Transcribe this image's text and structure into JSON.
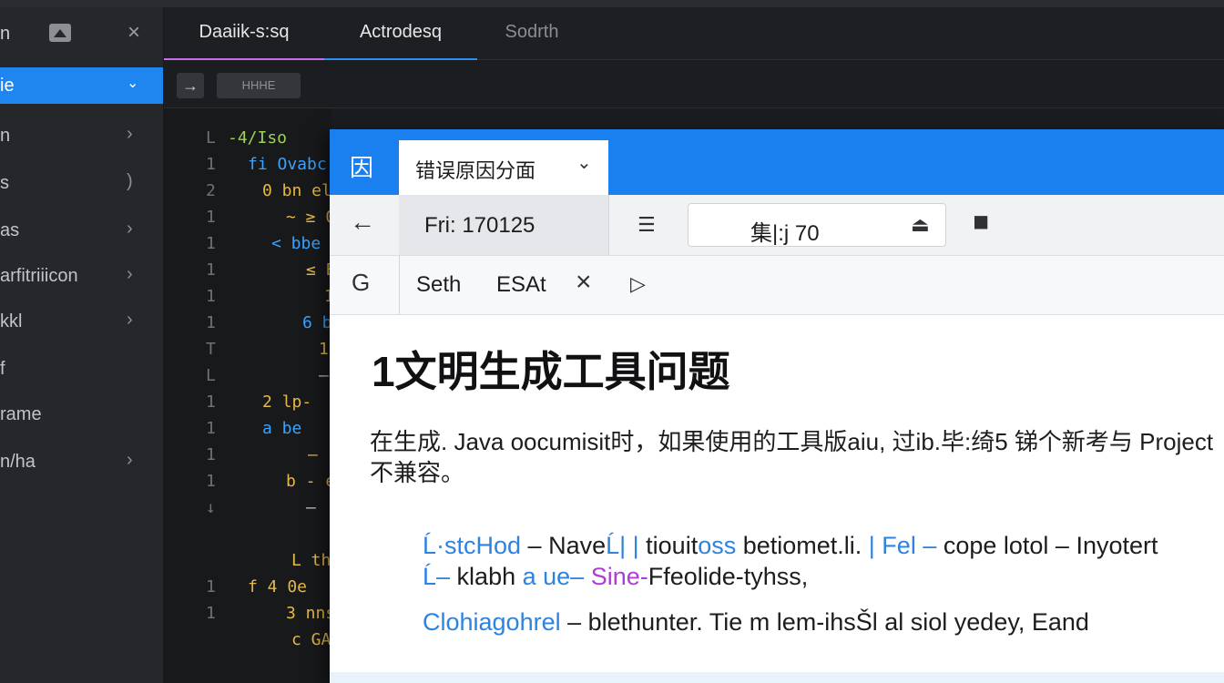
{
  "sidebar": {
    "header_text": "n",
    "items": [
      {
        "label": "ie",
        "chevron": "⌄",
        "active": true
      },
      {
        "label": "n",
        "chevron": "›"
      },
      {
        "label": "s",
        "chevron": ")"
      },
      {
        "label": "as",
        "chevron": "›"
      },
      {
        "label": "arfitriiicon",
        "chevron": "›"
      },
      {
        "label": "kkl",
        "chevron": "›"
      },
      {
        "label": "f",
        "chevron": ""
      },
      {
        "label": "rame",
        "chevron": ""
      },
      {
        "label": "n/ha",
        "chevron": "›"
      }
    ]
  },
  "tabs": [
    {
      "label": "Daaiik-s:sq"
    },
    {
      "label": "Actrodesq"
    },
    {
      "label": "Sodrth"
    }
  ],
  "toolbar": {
    "field_text": "HHHE"
  },
  "editor": {
    "lines": [
      {
        "ln": "L",
        "code": "-4/Iso",
        "color": "#9fd05a"
      },
      {
        "ln": "1",
        "code": "fi Ovabc",
        "color": "#3aa3ff"
      },
      {
        "ln": "2",
        "code": "0 bn el",
        "color": "#e6b84a"
      },
      {
        "ln": "1",
        "code": "~ ≥ 0",
        "color": "#e6b84a"
      },
      {
        "ln": "1",
        "code": "< bbe",
        "color": "#3aa3ff"
      },
      {
        "ln": "1",
        "code": "≤ E",
        "color": "#e6b84a"
      },
      {
        "ln": "1",
        "code": "1",
        "color": "#e6b84a"
      },
      {
        "ln": "1",
        "code": "6 bn",
        "color": "#3aa3ff"
      },
      {
        "ln": "T",
        "code": "1",
        "color": "#e6b84a"
      },
      {
        "ln": "L",
        "code": "—",
        "color": "#c9cacf"
      },
      {
        "ln": "1",
        "code": "2 lp-",
        "color": "#e6b84a"
      },
      {
        "ln": "1",
        "code": "a be",
        "color": "#3aa3ff"
      },
      {
        "ln": "1",
        "code": "—",
        "color": "#e6b84a"
      },
      {
        "ln": "1",
        "code": "b - e",
        "color": "#e6b84a"
      },
      {
        "ln": "↓",
        "code": "—",
        "color": "#c9cacf"
      },
      {
        "ln": "",
        "code": "",
        "color": "#c9cacf"
      },
      {
        "ln": "",
        "code": "L th",
        "color": "#e6b84a"
      },
      {
        "ln": "1",
        "code": "f 4 0e",
        "color": "#e6b84a"
      },
      {
        "ln": "1",
        "code": "3 nns",
        "color": "#e6b84a"
      },
      {
        "ln": "",
        "code": "c GA",
        "color": "#e6b84a"
      }
    ]
  },
  "dialog": {
    "app_icon": "因",
    "tab_label": "错误原因分面",
    "date_label": "Fri: 170125",
    "zoom_label": "集|:j  70",
    "search_label": "Seth",
    "esat_label": "ESAt",
    "title": "1文明生成工具问题",
    "paragraph": "在生成. Java oocumisit时，如果使用的工具版aiu, 过ib.毕:绮5 锑个新考与 Project不兼容。",
    "line1_parts": {
      "a": "Ĺ·stcHod",
      "b": " – Nave",
      "c": "Ĺ| |",
      "d": " tiouit",
      "e": "oss",
      "f": " betiomet.li. ",
      "g": "| Fel –",
      "h": " cope lotol – Inyotert"
    },
    "line2_parts": {
      "a": "Ĺ–",
      "b": " klabh ",
      "c": "a ue–",
      "d": " Sine-",
      "e": "Ffeolide-tyhss,"
    },
    "line3_parts": {
      "a": "Clohiagohrel",
      "b": " – blethunter. Tie m lem-ihsŠl al siol yedey, Eand"
    }
  },
  "colors": {
    "accent_blue": "#1f86f0",
    "tab_purple": "#c86cf0",
    "editor_bg": "#18191b"
  }
}
